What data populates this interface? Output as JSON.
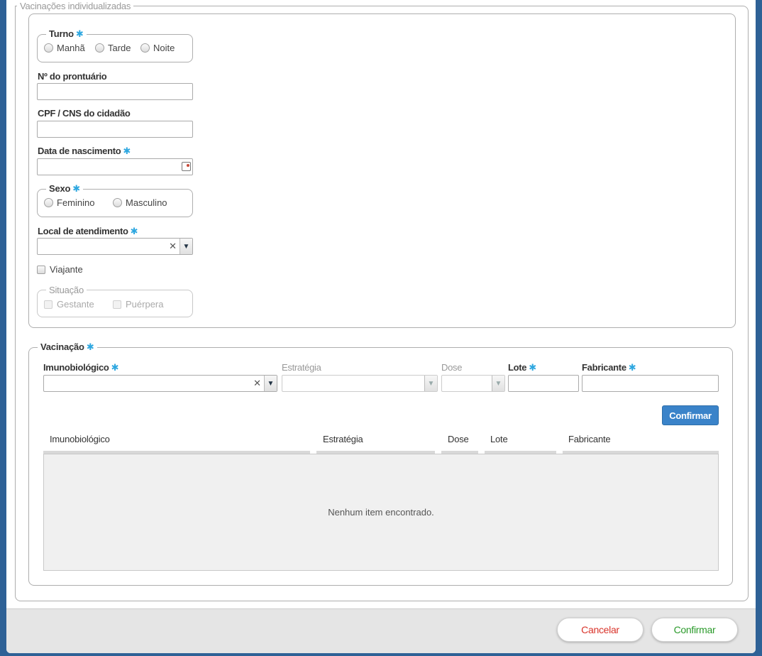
{
  "outer": {
    "legend": "Vacinações individualizadas"
  },
  "turno": {
    "legend": "Turno",
    "options": [
      "Manhã",
      "Tarde",
      "Noite"
    ]
  },
  "prontuario": {
    "label": "Nº do prontuário",
    "value": ""
  },
  "cpf": {
    "label": "CPF / CNS do cidadão",
    "value": ""
  },
  "nascimento": {
    "label": "Data de nascimento",
    "value": ""
  },
  "sexo": {
    "legend": "Sexo",
    "options": [
      "Feminino",
      "Masculino"
    ]
  },
  "local": {
    "label": "Local de atendimento",
    "value": ""
  },
  "viajante": {
    "label": "Viajante"
  },
  "situacao": {
    "legend": "Situação",
    "options": [
      "Gestante",
      "Puérpera"
    ]
  },
  "vacinacao": {
    "legend": "Vacinação",
    "fields": {
      "imunobiologico": "Imunobiológico",
      "estrategia": "Estratégia",
      "dose": "Dose",
      "lote": "Lote",
      "fabricante": "Fabricante"
    },
    "confirm_label": "Confirmar",
    "table": {
      "columns": [
        "Imunobiológico",
        "Estratégia",
        "Dose",
        "Lote",
        "Fabricante"
      ],
      "empty_text": "Nenhum item encontrado."
    }
  },
  "required_marker": "✱",
  "footer": {
    "cancel_label": "Cancelar",
    "confirm_label": "Confirmar"
  },
  "colors": {
    "background": "#2e6196",
    "accent": "#3a83c9",
    "required": "#2ea7e0",
    "cancel": "#d9342b",
    "confirm": "#2a9a2a"
  }
}
